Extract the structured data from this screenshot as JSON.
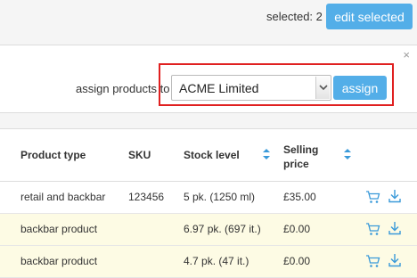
{
  "topbar": {
    "selected_text": "selected: 2",
    "edit_button": "edit selected"
  },
  "assign_panel": {
    "close_symbol": "×",
    "label": "assign products to",
    "select_value": "ACME Limited",
    "assign_button": "assign"
  },
  "table": {
    "headers": {
      "product_type": "Product type",
      "sku": "SKU",
      "stock_level": "Stock level",
      "selling_price_line1": "Selling",
      "selling_price_line2": "price"
    },
    "rows": [
      {
        "product_type": "retail and backbar",
        "sku": "123456",
        "stock_level": "5 pk. (1250 ml)",
        "selling_price": "£35.00"
      },
      {
        "product_type": "backbar product",
        "sku": "",
        "stock_level": "6.97 pk. (697 it.)",
        "selling_price": "£0.00"
      },
      {
        "product_type": "backbar product",
        "sku": "",
        "stock_level": "4.7 pk. (47 it.)",
        "selling_price": "£0.00"
      }
    ]
  },
  "colors": {
    "primary_button": "#53aee8",
    "icon_blue": "#3a9ad9",
    "highlight_border": "#e02020",
    "row_highlight": "#fdfbe4"
  },
  "icons": [
    "close-icon",
    "chevron-down-icon",
    "sort-icon",
    "cart-icon",
    "download-icon"
  ]
}
